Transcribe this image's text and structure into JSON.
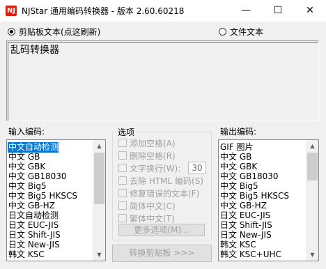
{
  "window": {
    "title": "NJStar 通用编码转换器 - 版本 2.60.60218",
    "app_icon": "NJ",
    "controls": {
      "minimize": "—",
      "maximize": "☐",
      "close": "✕"
    }
  },
  "source": {
    "clipboard_text_label": "剪贴板文本(点这刷新)",
    "file_text_label": "文件文本",
    "selected": "clipboard"
  },
  "preview_text": "乱码转换器",
  "input_encoding": {
    "label": "输入编码:",
    "selected_index": 0,
    "items": [
      "中文自动检测",
      "中文 GB",
      "中文 GBK",
      "中文 GB18030",
      "中文 Big5",
      "中文 Big5 HKSCS",
      "中文 GB-HZ",
      "日文自动检测",
      "日文 EUC-JIS",
      "日文 Shift-JIS",
      "日文 New-JIS",
      "韩文 KSC"
    ]
  },
  "options": {
    "title": "选项",
    "add_space": "添加空格(A)",
    "delete_space": "删除空格(R)",
    "wrap_text": "文字换行(W):",
    "wrap_value": "30",
    "strip_html": "去除 HTML 编码(S)",
    "fix_text": "修复错误的文本(F)",
    "simplified": "简体中文(C)",
    "traditional": "繁体中文(T)",
    "more_options": "更多选项(M)..."
  },
  "convert_button": "转换剪贴板 >>>",
  "output_encoding": {
    "label": "输出编码:",
    "items": [
      "GIF 图片",
      "中文 GB",
      "中文 GBK",
      "中文 GB18030",
      "中文 Big5",
      "中文 Big5 HKSCS",
      "中文 GB-HZ",
      "日文 EUC-JIS",
      "日文 Shift-JIS",
      "日文 New-JIS",
      "韩文 KSC",
      "韩文 KSC+UHC"
    ]
  },
  "colors": {
    "selection": "#0078d7",
    "window_bg": "#f0f0f0",
    "app_icon": "#d81e06"
  }
}
